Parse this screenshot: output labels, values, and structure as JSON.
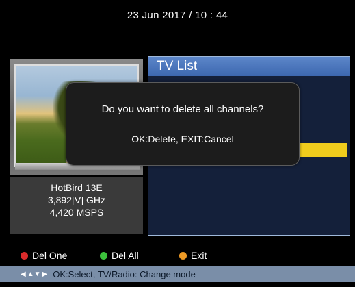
{
  "header": {
    "datetime": "23 Jun 2017 / 10 : 44"
  },
  "satellite": {
    "name": "HotBird 13E",
    "frequency": "3,892[V] GHz",
    "symbol_rate": "4,420 MSPS"
  },
  "channel_list": {
    "title": "TV List"
  },
  "dialog": {
    "question": "Do you want to delete all channels?",
    "hint": "OK:Delete, EXIT:Cancel"
  },
  "legend": {
    "del_one": {
      "label": "Del One",
      "color": "#d92b2b"
    },
    "del_all": {
      "label": "Del All",
      "color": "#3cc13c"
    },
    "exit": {
      "label": "Exit",
      "color": "#ee9a25"
    }
  },
  "helpbar": {
    "icons": [
      "left-arrow-icon",
      "up-down-arrow-icon",
      "right-arrow-icon"
    ],
    "text": "OK:Select, TV/Radio: Change mode"
  }
}
